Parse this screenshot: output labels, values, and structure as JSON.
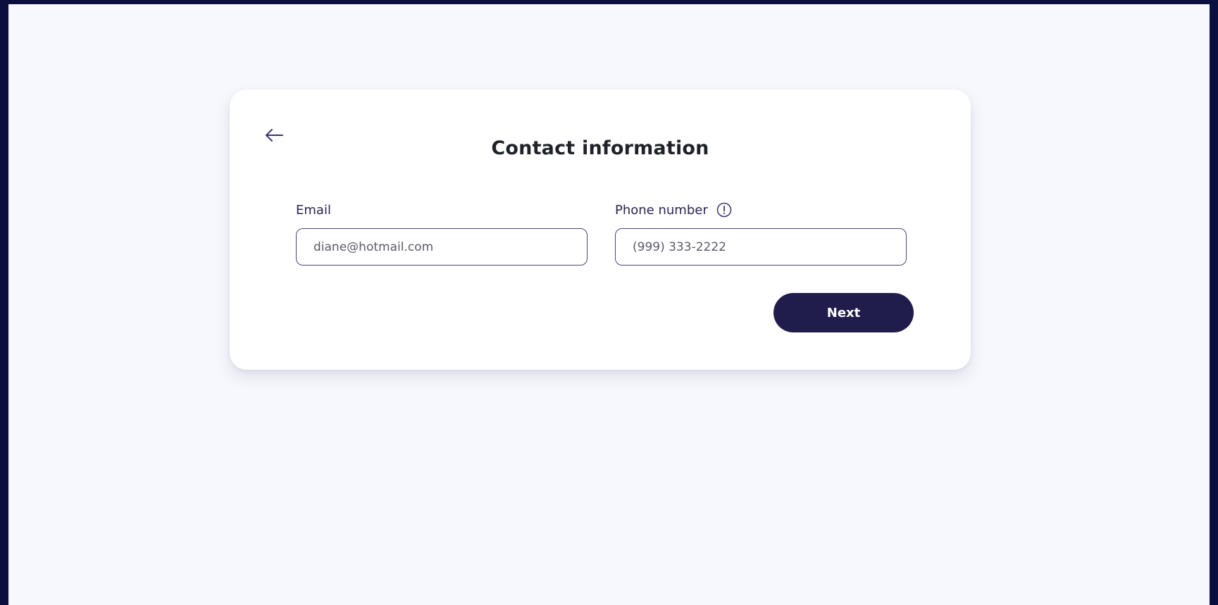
{
  "form": {
    "title": "Contact information",
    "back_icon": "arrow-left-icon",
    "email": {
      "label": "Email",
      "placeholder": "diane@hotmail.com",
      "value": ""
    },
    "phone": {
      "label": "Phone number",
      "info_icon": "info-circle-icon",
      "placeholder": "(999) 333-2222",
      "value": ""
    },
    "next_label": "Next"
  },
  "colors": {
    "frame": "#0b0f3f",
    "background": "#f7f8fd",
    "card": "#ffffff",
    "primary": "#201c4c",
    "input_border": "#4b4577",
    "title_text": "#1f2329"
  }
}
